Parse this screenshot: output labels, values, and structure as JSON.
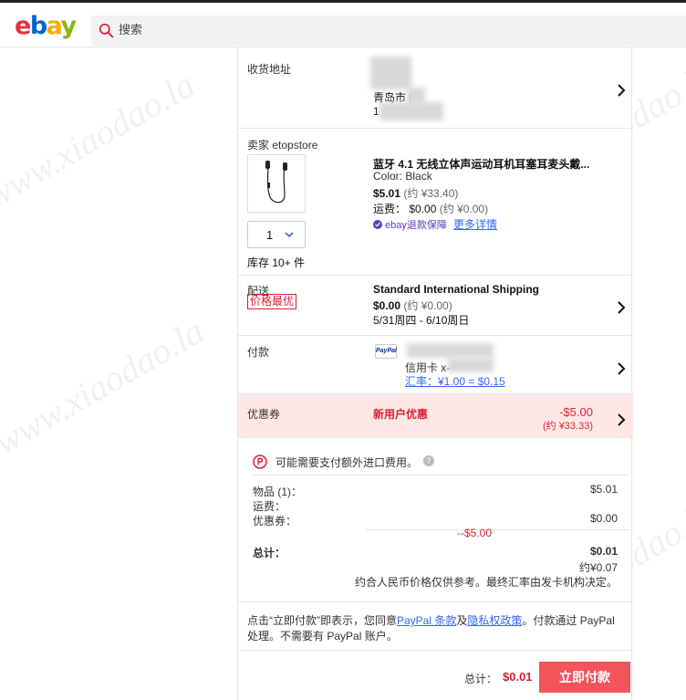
{
  "header": {
    "logo": [
      "e",
      "b",
      "a",
      "y"
    ],
    "search_placeholder": "搜索"
  },
  "address": {
    "label": "收货地址",
    "city": "青岛市 l",
    "line2": "1"
  },
  "item": {
    "seller": "卖家 etopstore",
    "title": "蓝牙 4.1 无线立体声运动耳机耳塞耳麦头戴...",
    "color": "Color: Black",
    "price": "$5.01",
    "price_cny": "(约 ¥33.40)",
    "shipping_label": "运费：",
    "shipping": "$0.00",
    "shipping_cny": "(约 ¥0.00)",
    "guarantee": "ebay退款保障",
    "more_details": "更多详情",
    "quantity": "1",
    "stock": "库存 10+ 件"
  },
  "delivery": {
    "label": "配送",
    "badge": "价格最优",
    "method": "Standard International Shipping",
    "cost": "$0.00",
    "cost_cny": "(约 ¥0.00)",
    "dates": "5/31周四 - 6/10周日"
  },
  "payment": {
    "label": "付款",
    "paypal_icon_text": "PayPal",
    "card": "信用卡 x-",
    "rate": "汇率：¥1.00 = $0.15"
  },
  "coupon": {
    "label": "优惠券",
    "name": "新用户优惠",
    "amount": "-$5.00",
    "amount_cny": "(约 ¥33.33)"
  },
  "summary": {
    "import_note": "可能需要支付额外进口费用。",
    "items_label": "物品 (1)：",
    "items_value": "$5.01",
    "shipping_label": "运费：",
    "shipping_value": "$0.00",
    "coupon_label": "优惠券：",
    "coupon_value": "--$5.00",
    "total_label": "总计：",
    "total_value": "$0.01",
    "total_cny": "约¥0.07",
    "rate_note": "约合人民币价格仅供参考。最终汇率由发卡机构决定。"
  },
  "terms": {
    "prefix": "点击“立即付款”即表示，您同意",
    "paypal_terms": "PayPal 条款",
    "and": "及",
    "privacy": "隐私权政策",
    "suffix": "。付款通过 PayPal",
    "line2": "处理。不需要有 PayPal 账户。"
  },
  "footer": {
    "total_label": "总计：",
    "total_value": "$0.01",
    "pay_button": "立即付款"
  },
  "watermark": "www.xiaodao.la",
  "colors": {
    "accent_red": "#dd1e31",
    "link_blue": "#3665f3",
    "pay_button": "#f2545b",
    "coupon_bg": "#fde8e6"
  }
}
